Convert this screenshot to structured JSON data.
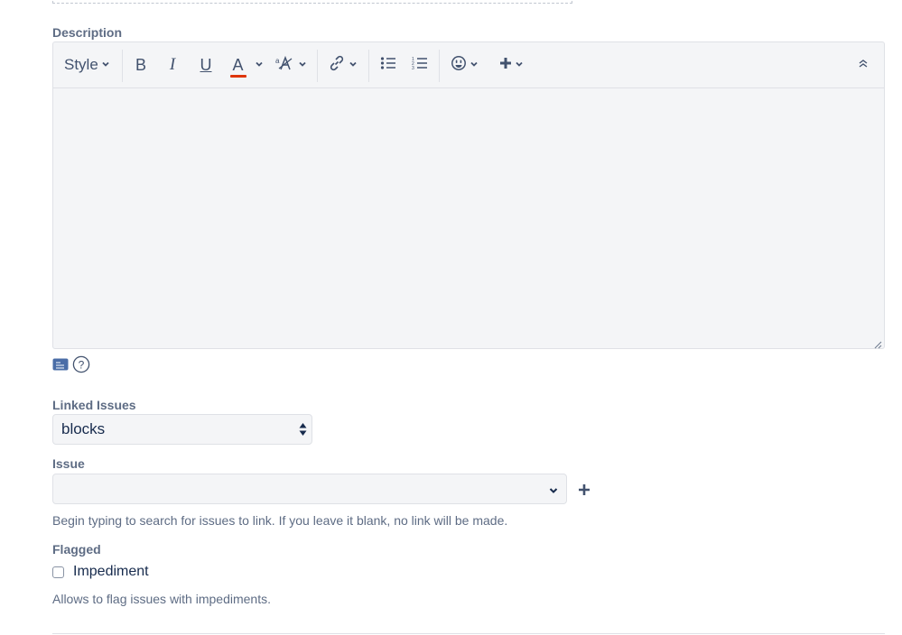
{
  "description": {
    "label": "Description",
    "toolbar": {
      "style_label": "Style",
      "icons": [
        "bold-icon",
        "italic-icon",
        "underline-icon",
        "text-color-icon",
        "text-style-icon",
        "link-icon",
        "bullet-list-icon",
        "numbered-list-icon",
        "emoji-icon",
        "insert-plus-icon",
        "collapse-toolbar-icon"
      ],
      "bold": "B",
      "italic": "I",
      "underline": "U",
      "text_color": "A",
      "text_color_accent": "#de350b"
    },
    "editor_value": ""
  },
  "below_editor_icons": [
    "attachment-icon",
    "help-icon"
  ],
  "linked_issues": {
    "label": "Linked Issues",
    "selected": "blocks"
  },
  "issue": {
    "label": "Issue",
    "value": "",
    "help": "Begin typing to search for issues to link. If you leave it blank, no link will be made."
  },
  "flagged": {
    "label": "Flagged",
    "checkbox_label": "Impediment",
    "checked": false,
    "help": "Allows to flag issues with impediments."
  }
}
